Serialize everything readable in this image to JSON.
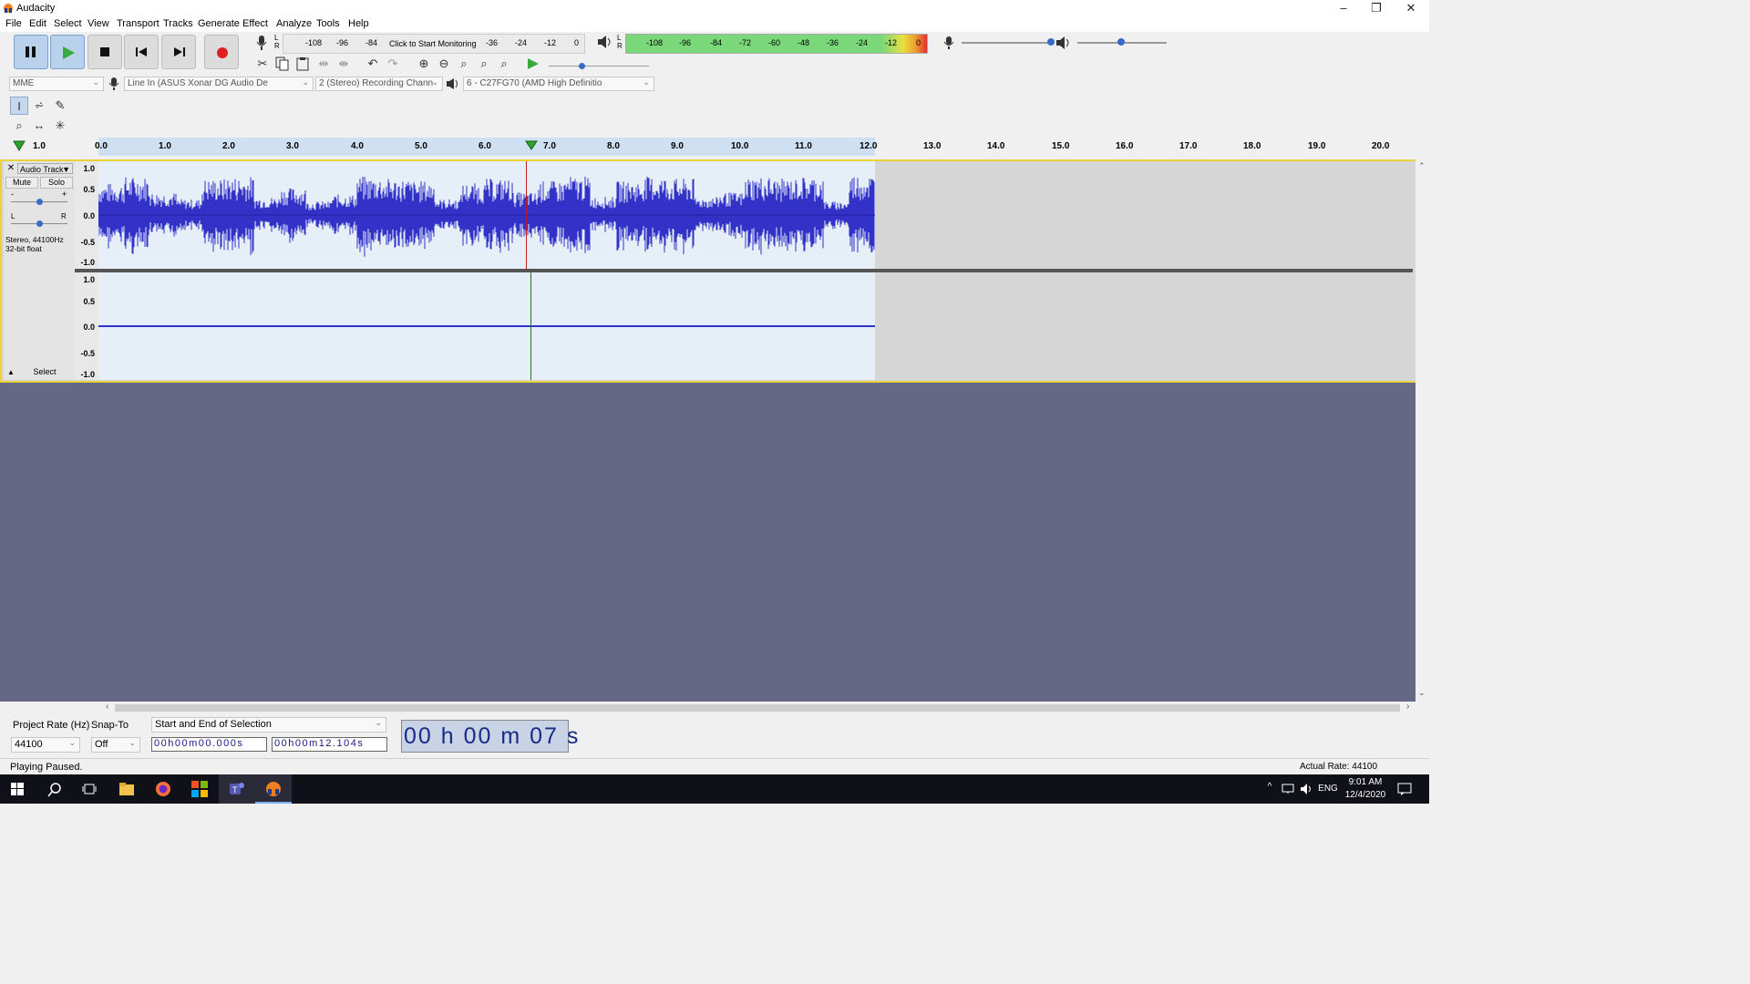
{
  "window": {
    "title": "Audacity",
    "controls": [
      "–",
      "❐",
      "✕"
    ]
  },
  "menu": [
    "File",
    "Edit",
    "Select",
    "View",
    "Transport",
    "Tracks",
    "Generate",
    "Effect",
    "Analyze",
    "Tools",
    "Help"
  ],
  "transport": {
    "pause": "pause",
    "play": "play",
    "stop": "stop",
    "skip_start": "skip-to-start",
    "skip_end": "skip-to-end",
    "record": "record"
  },
  "recording_meter": {
    "lr": "L\nR",
    "prompt": "Click to Start Monitoring",
    "ticks_left": [
      "-108",
      "-96",
      "-84"
    ],
    "ticks_right": [
      "-36",
      "-24",
      "-12",
      "0"
    ]
  },
  "playback_meter": {
    "ticks": [
      "-108",
      "-96",
      "-84",
      "-72",
      "-60",
      "-48",
      "-36",
      "-24",
      "-12",
      "0"
    ]
  },
  "device": {
    "host": "MME",
    "input": "Line In (ASUS Xonar DG Audio De",
    "channels": "2 (Stereo) Recording Chann",
    "output": "6 - C27FG70 (AMD High Definitio"
  },
  "ruler": {
    "left_label": "1.0",
    "ticks": [
      "0.0",
      "1.0",
      "2.0",
      "3.0",
      "4.0",
      "5.0",
      "6.0",
      "7.0",
      "8.0",
      "9.0",
      "10.0",
      "11.0",
      "12.0",
      "13.0",
      "14.0",
      "15.0",
      "16.0",
      "17.0",
      "18.0",
      "19.0",
      "20.0"
    ]
  },
  "track": {
    "name": "Audio Track",
    "mute": "Mute",
    "solo": "Solo",
    "gain_minus": "-",
    "gain_plus": "+",
    "pan_left": "L",
    "pan_right": "R",
    "info_line1": "Stereo, 44100Hz",
    "info_line2": "32-bit float",
    "select": "Select",
    "vscale": [
      "1.0",
      "0.5",
      "0.0",
      "-0.5",
      "-1.0"
    ]
  },
  "selection_toolbar": {
    "project_rate_label": "Project Rate (Hz)",
    "project_rate_value": "44100",
    "snap_label": "Snap-To",
    "snap_value": "Off",
    "selection_mode": "Start and End of Selection",
    "start_time": "00h00m00.000s",
    "end_time": "00h00m12.104s",
    "audio_position": "00 h 00 m 07 s"
  },
  "status": {
    "left": "Playing Paused.",
    "right": "Actual Rate: 44100"
  },
  "taskbar": {
    "lang": "ENG",
    "time": "9:01 AM",
    "date": "12/4/2020"
  },
  "colors": {
    "waveform": "#3232c8",
    "selection": "#e6eef8",
    "background": "#646884",
    "meter_green": "#7ad87a"
  }
}
